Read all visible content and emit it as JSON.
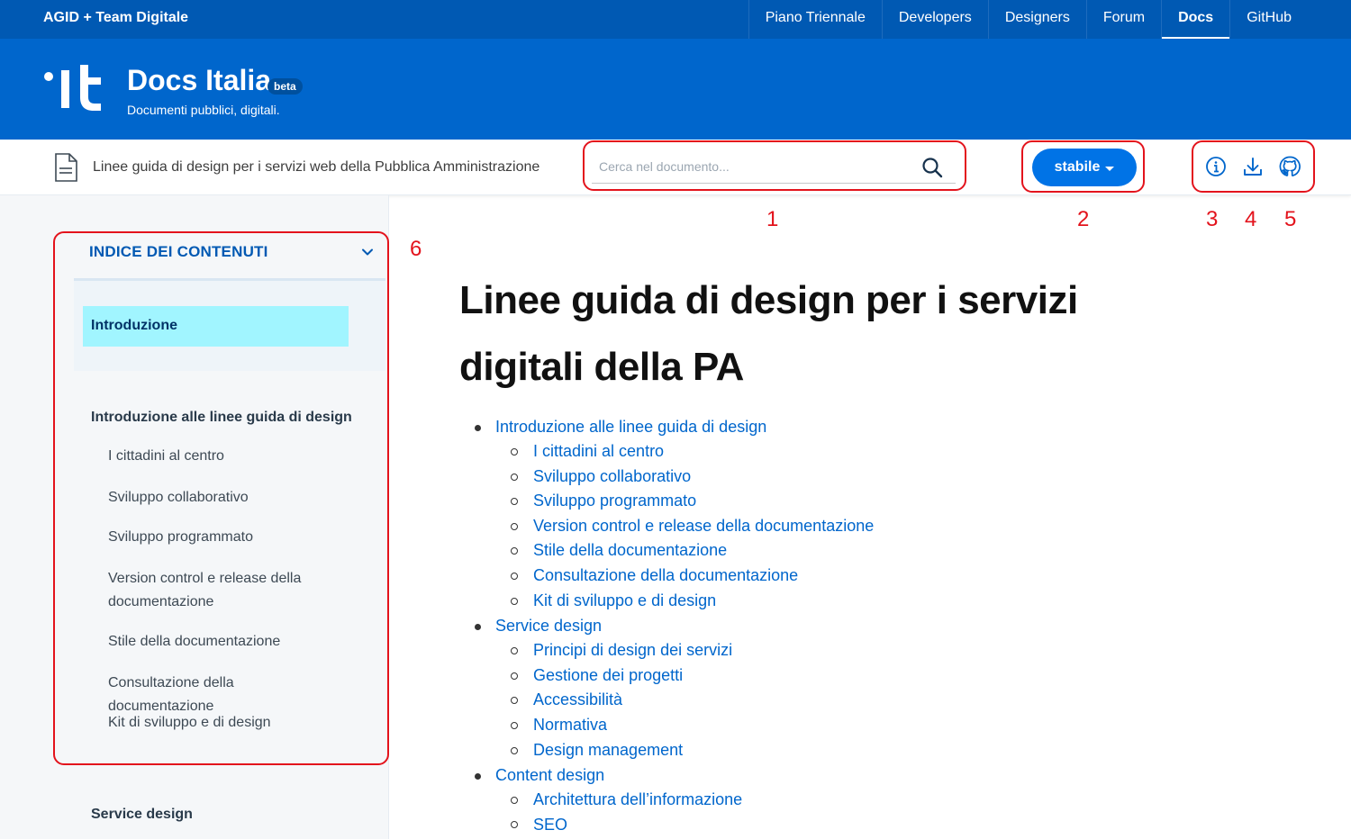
{
  "topbar": {
    "org": "AGID + Team Digitale",
    "nav": [
      {
        "label": "Piano Triennale",
        "active": false
      },
      {
        "label": "Developers",
        "active": false
      },
      {
        "label": "Designers",
        "active": false
      },
      {
        "label": "Forum",
        "active": false
      },
      {
        "label": "Docs",
        "active": true
      },
      {
        "label": "GitHub",
        "active": false
      }
    ]
  },
  "header": {
    "logo_text": "•it",
    "title": "Docs Italia",
    "badge": "beta",
    "subtitle": "Documenti pubblici, digitali."
  },
  "toolbar": {
    "doc_title": "Linee guida di design per i servizi web della Pubblica Amministrazione",
    "search_placeholder": "Cerca nel documento...",
    "version_label": "stabile",
    "icons": [
      "info-icon",
      "download-icon",
      "github-icon"
    ]
  },
  "annotations": [
    "1",
    "2",
    "3",
    "4",
    "5",
    "6"
  ],
  "sidebar": {
    "toc_heading": "INDICE DEI CONTENUTI",
    "current": "Introduzione",
    "section1": "Introduzione alle linee guida di design",
    "section1_items": [
      "I cittadini al centro",
      "Sviluppo collaborativo",
      "Sviluppo programmato",
      "Version control e release della documentazione",
      "Stile della documentazione",
      "Consultazione della documentazione",
      "Kit di sviluppo e di design"
    ],
    "section2": "Service design"
  },
  "main": {
    "title": "Linee guida di design per i servizi digitali della PA",
    "list": [
      {
        "label": "Introduzione alle linee guida di design",
        "children": [
          "I cittadini al centro",
          "Sviluppo collaborativo",
          "Sviluppo programmato",
          "Version control e release della documentazione",
          "Stile della documentazione",
          "Consultazione della documentazione",
          "Kit di sviluppo e di design"
        ]
      },
      {
        "label": "Service design",
        "children": [
          "Principi di design dei servizi",
          "Gestione dei progetti",
          "Accessibilità",
          "Normativa",
          "Design management"
        ]
      },
      {
        "label": "Content design",
        "children": [
          "Architettura dell’informazione",
          "SEO"
        ]
      }
    ]
  },
  "colors": {
    "topbar": "#0059b3",
    "header": "#0066cc",
    "accent": "#0073e6",
    "annotation": "#e3131c",
    "highlight": "#a1f5ff"
  }
}
